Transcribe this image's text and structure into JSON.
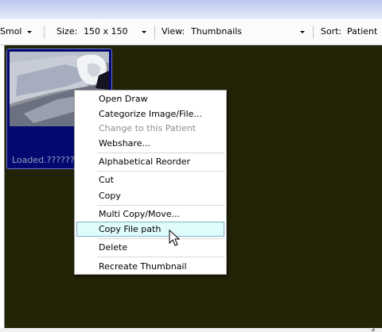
{
  "toolbar": {
    "sort_label_partial": "Smol",
    "size_label": "Size:",
    "size_value": "150 x 150",
    "view_label": "View:",
    "view_value": "Thumbnails",
    "sort_label": "Sort:",
    "sort_value": "Patient"
  },
  "thumbnail": {
    "caption": "Loaded.??????"
  },
  "context_menu": {
    "items": [
      {
        "label": "Open Draw"
      },
      {
        "label": "Categorize Image/File..."
      },
      {
        "label": "Change to this Patient",
        "disabled": true
      },
      {
        "label": "Webshare..."
      },
      {
        "label": "Alphabetical Reorder"
      },
      {
        "label": "Cut"
      },
      {
        "label": "Copy"
      },
      {
        "label": "Multi Copy/Move..."
      },
      {
        "label": "Copy File path",
        "highlighted": true
      },
      {
        "label": "Delete"
      },
      {
        "label": "Recreate Thumbnail"
      }
    ]
  },
  "colors": {
    "gallery_background": "#232308",
    "thumbnail_selected": "#020870",
    "menu_highlight": "#e0fbfb"
  }
}
